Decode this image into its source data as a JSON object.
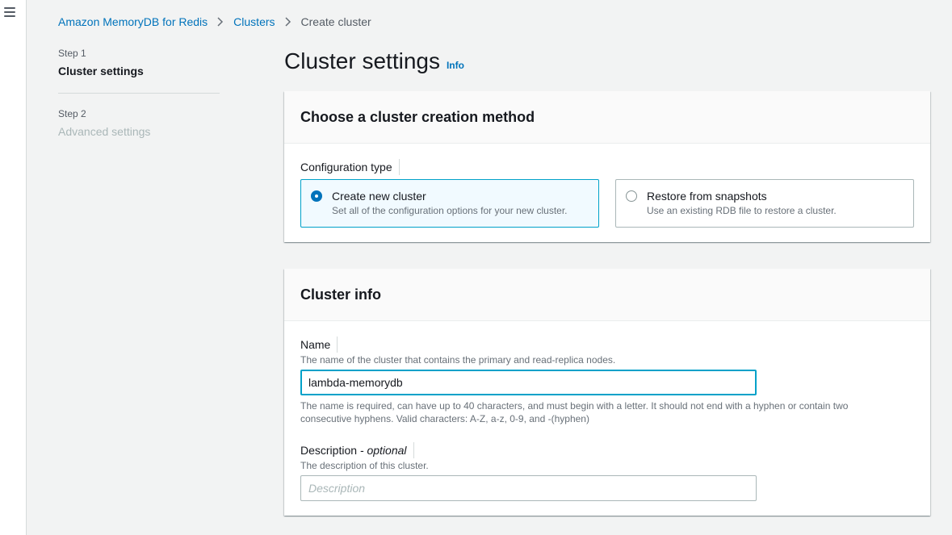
{
  "breadcrumb": {
    "items": [
      "Amazon MemoryDB for Redis",
      "Clusters"
    ],
    "current": "Create cluster"
  },
  "steps": [
    {
      "number": "Step 1",
      "title": "Cluster settings"
    },
    {
      "number": "Step 2",
      "title": "Advanced settings"
    }
  ],
  "page": {
    "title": "Cluster settings",
    "info": "Info"
  },
  "creation_method": {
    "header": "Choose a cluster creation method",
    "label": "Configuration type",
    "options": [
      {
        "title": "Create new cluster",
        "description": "Set all of the configuration options for your new cluster.",
        "selected": true
      },
      {
        "title": "Restore from snapshots",
        "description": "Use an existing RDB file to restore a cluster.",
        "selected": false
      }
    ]
  },
  "cluster_info": {
    "header": "Cluster info",
    "name": {
      "label": "Name",
      "description": "The name of the cluster that contains the primary and read-replica nodes.",
      "value": "lambda-memorydb",
      "constraint": "The name is required, can have up to 40 characters, and must begin with a letter. It should not end with a hyphen or contain two consecutive hyphens. Valid characters: A-Z, a-z, 0-9, and -(hyphen)"
    },
    "description_field": {
      "label": "Description",
      "optional": "- optional",
      "description": "The description of this cluster.",
      "placeholder": "Description"
    }
  },
  "colors": {
    "link": "#0073bb",
    "selected_border": "#00a1c9",
    "selected_bg": "#f1faff",
    "page_bg": "#f2f3f3"
  }
}
